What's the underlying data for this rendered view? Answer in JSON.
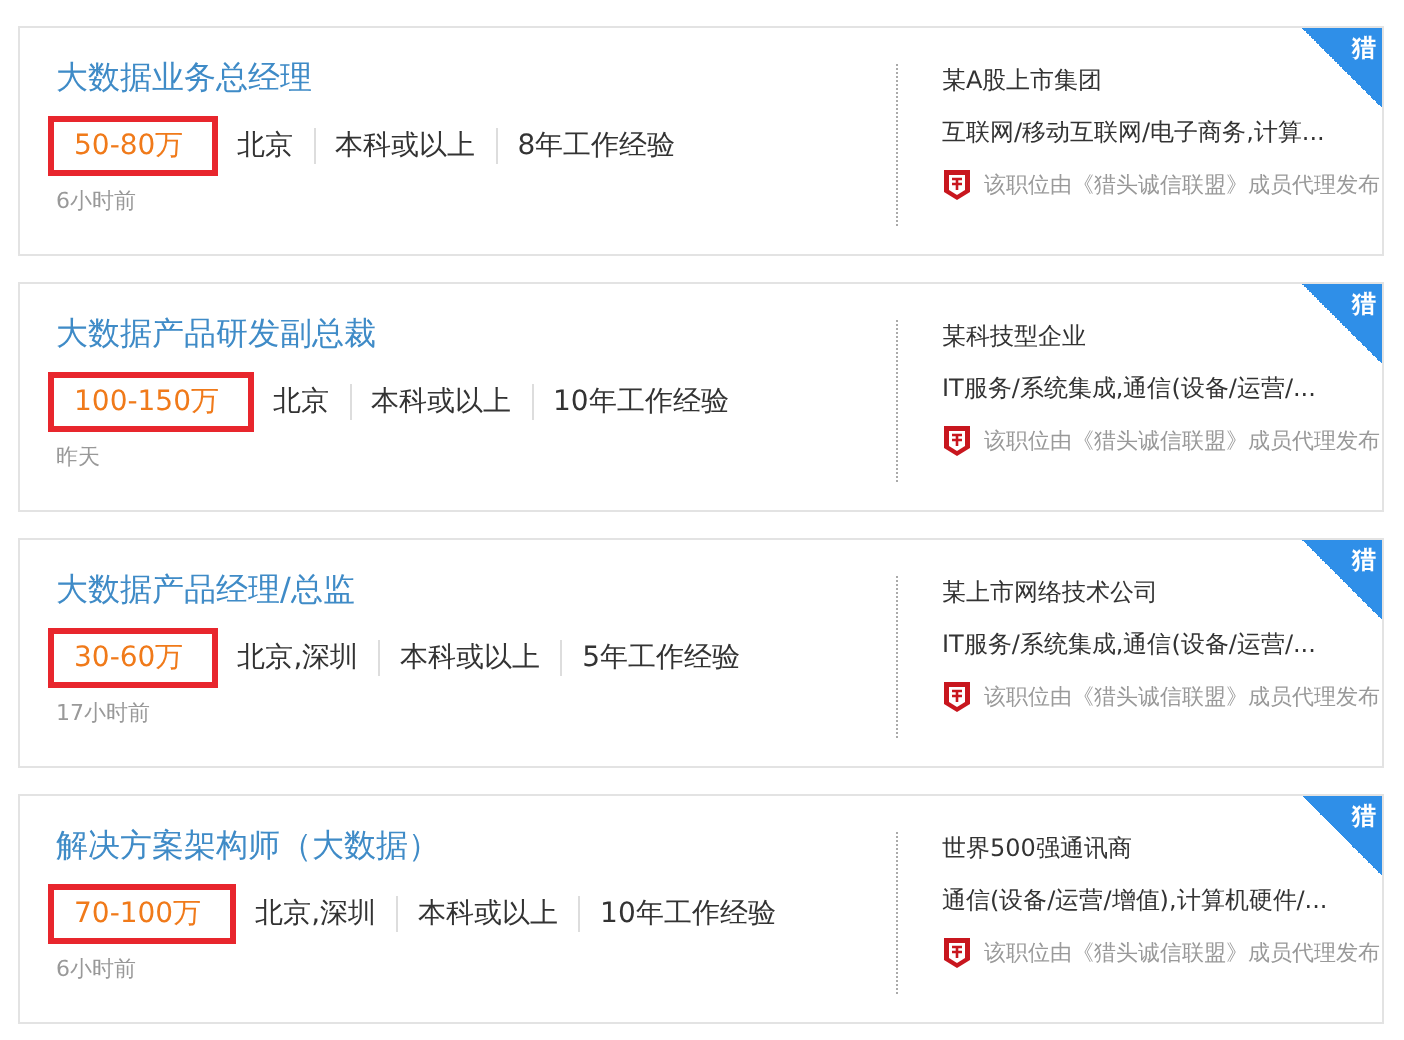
{
  "jobs": [
    {
      "title": "大数据业务总经理",
      "salary": "50-80万",
      "salary_highlighted": true,
      "meta": [
        "北京",
        "本科或以上",
        "8年工作经验"
      ],
      "time": "6小时前",
      "company": "某A股上市集团",
      "industry": "互联网/移动互联网/电子商务,计算...",
      "note": "该职位由《猎头诚信联盟》成员代理发布",
      "badge": "猎"
    },
    {
      "title": "大数据产品研发副总裁",
      "salary": "100-150万",
      "salary_highlighted": true,
      "meta": [
        "北京",
        "本科或以上",
        "10年工作经验"
      ],
      "time": "昨天",
      "company": "某科技型企业",
      "industry": "IT服务/系统集成,通信(设备/运营/...",
      "note": "该职位由《猎头诚信联盟》成员代理发布",
      "badge": "猎"
    },
    {
      "title": "大数据产品经理/总监",
      "salary": "30-60万",
      "salary_highlighted": true,
      "meta": [
        "北京,深圳",
        "本科或以上",
        "5年工作经验"
      ],
      "time": "17小时前",
      "company": "某上市网络技术公司",
      "industry": "IT服务/系统集成,通信(设备/运营/...",
      "note": "该职位由《猎头诚信联盟》成员代理发布",
      "badge": "猎"
    },
    {
      "title": "解决方案架构师（大数据）",
      "salary": "70-100万",
      "salary_highlighted": true,
      "meta": [
        "北京,深圳",
        "本科或以上",
        "10年工作经验"
      ],
      "time": "6小时前",
      "company": "世界500强通讯商",
      "industry": "通信(设备/运营/增值),计算机硬件/...",
      "note": "该职位由《猎头诚信联盟》成员代理发布",
      "badge": "猎"
    }
  ]
}
